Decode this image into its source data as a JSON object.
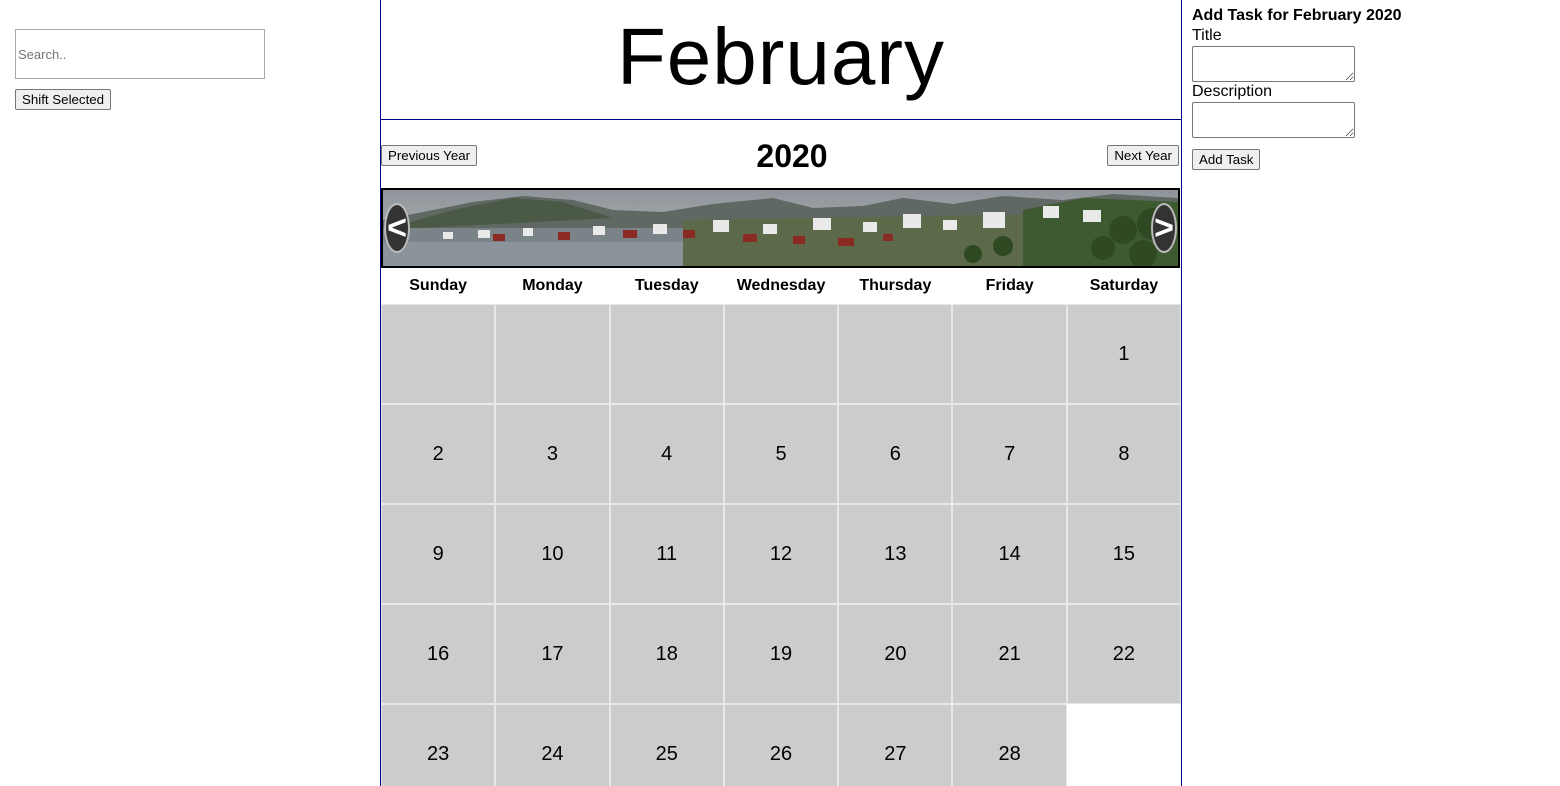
{
  "sidebar": {
    "search_placeholder": "Search..",
    "shift_button": "Shift Selected"
  },
  "calendar": {
    "month": "February",
    "year": "2020",
    "prev_year_button": "Previous Year",
    "next_year_button": "Next Year",
    "slider": {
      "prev_arrow": "<",
      "next_arrow": ">"
    },
    "weekdays": [
      "Sunday",
      "Monday",
      "Tuesday",
      "Wednesday",
      "Thursday",
      "Friday",
      "Saturday"
    ],
    "days": [
      "",
      "",
      "",
      "",
      "",
      "",
      "1",
      "2",
      "3",
      "4",
      "5",
      "6",
      "7",
      "8",
      "9",
      "10",
      "11",
      "12",
      "13",
      "14",
      "15",
      "16",
      "17",
      "18",
      "19",
      "20",
      "21",
      "22",
      "23",
      "24",
      "25",
      "26",
      "27",
      "28",
      ""
    ]
  },
  "task_form": {
    "heading": "Add Task for February 2020",
    "title_label": "Title",
    "title_value": "",
    "description_label": "Description",
    "description_value": "",
    "add_button": "Add Task"
  },
  "colors": {
    "day_cell": "#cccccc",
    "calendar_border": "#00008b"
  }
}
